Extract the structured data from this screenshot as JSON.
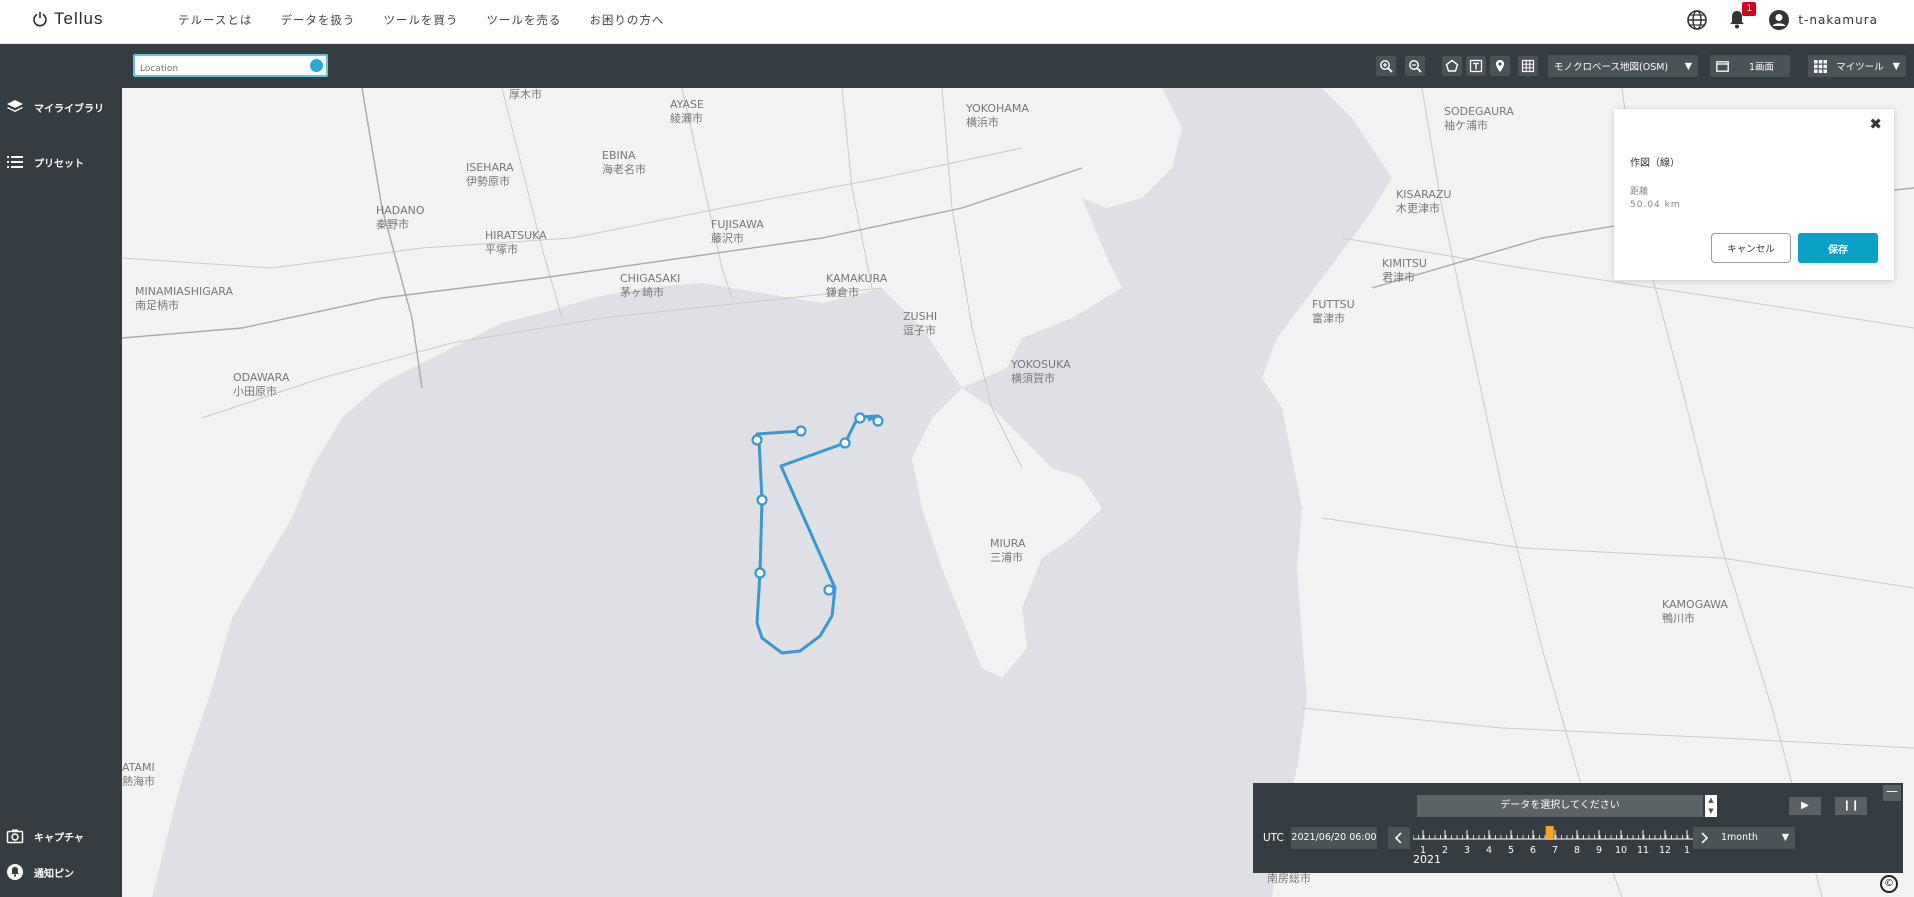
{
  "header": {
    "logo_text": "Tellus",
    "nav": [
      "テルースとは",
      "データを扱う",
      "ツールを買う",
      "ツールを売る",
      "お困りの方へ"
    ],
    "notification_count": "1",
    "username": "t-nakamura"
  },
  "sidebar": {
    "items": [
      {
        "label": "マイライブラリ",
        "icon": "layers-icon"
      },
      {
        "label": "プリセット",
        "icon": "list-icon"
      }
    ],
    "bottom_items": [
      {
        "label": "キャプチャ",
        "icon": "camera-icon"
      },
      {
        "label": "通知ピン",
        "icon": "pin-icon"
      }
    ]
  },
  "toolbar": {
    "search_placeholder": "Location",
    "basemap": "モノクロベース地図(OSM)",
    "screen_mode": "1画面",
    "my_tools": "マイツール"
  },
  "map": {
    "cities": [
      {
        "en": "",
        "jp": "厚木市"
      },
      {
        "en": "AYASE",
        "jp": "綾瀬市"
      },
      {
        "en": "YOKOHAMA",
        "jp": "横浜市"
      },
      {
        "en": "EBINA",
        "jp": "海老名市"
      },
      {
        "en": "ISEHARA",
        "jp": "伊勢原市"
      },
      {
        "en": "HADANO",
        "jp": "秦野市"
      },
      {
        "en": "HIRATSUKA",
        "jp": "平塚市"
      },
      {
        "en": "FUJISAWA",
        "jp": "藤沢市"
      },
      {
        "en": "CHIGASAKI",
        "jp": "茅ヶ崎市"
      },
      {
        "en": "KAMAKURA",
        "jp": "鎌倉市"
      },
      {
        "en": "ZUSHI",
        "jp": "逗子市"
      },
      {
        "en": "MINAMIASHIGARA",
        "jp": "南足柄市"
      },
      {
        "en": "ODAWARA",
        "jp": "小田原市"
      },
      {
        "en": "YOKOSUKA",
        "jp": "横須賀市"
      },
      {
        "en": "MIURA",
        "jp": "三浦市"
      },
      {
        "en": "SODEGAURA",
        "jp": "袖ケ浦市"
      },
      {
        "en": "KISARAZU",
        "jp": "木更津市"
      },
      {
        "en": "KIMITSU",
        "jp": "君津市"
      },
      {
        "en": "FUTTSU",
        "jp": "富津市"
      },
      {
        "en": "KAMOGAWA",
        "jp": "鴨川市"
      },
      {
        "en": "",
        "jp": "南房総市"
      },
      {
        "en": "ATAMI",
        "jp": "熱海市"
      }
    ]
  },
  "draw_panel": {
    "title": "作図（線）",
    "distance_label": "距離",
    "distance_value": "50.04 km",
    "cancel_label": "キャンセル",
    "save_label": "保存"
  },
  "timeline": {
    "prompt": "データを選択してください",
    "utc_label": "UTC",
    "date": "2021/06/20 06:00",
    "months": [
      "1",
      "2",
      "3",
      "4",
      "5",
      "6",
      "7",
      "8",
      "9",
      "10",
      "11",
      "12",
      "1"
    ],
    "year": "2021",
    "period": "1month",
    "play_symbol": "▶",
    "pause_symbol": "❙❙",
    "minimize_symbol": "—",
    "selected_month_fraction": 0.48
  },
  "attribution": "©",
  "colors": {
    "sidebar_bg": "#353d42",
    "accent": "#0aa1c4",
    "route_line": "#3a97cf",
    "timeline_highlight": "#f5a623",
    "notification_badge": "#d0021b"
  }
}
